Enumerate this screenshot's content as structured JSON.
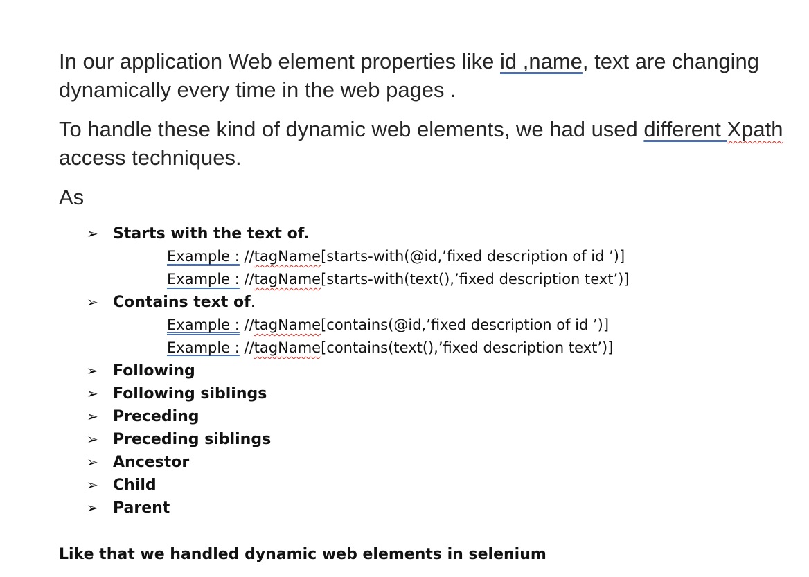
{
  "para1": {
    "text_a": "In our application Web element properties like ",
    "text_idname": "id ,name",
    "text_b": ", text are changing dynamically every time in the web pages ."
  },
  "para2": {
    "text_a": "To handle these kind of dynamic web elements, we had used ",
    "text_different": "different  ",
    "text_xpath": "Xpath",
    "text_b": " access techniques."
  },
  "para3": {
    "text": "As"
  },
  "bullet_glyph": "➢",
  "list": {
    "starts_with": "Starts with the text of.",
    "contains_label": "Contains text of",
    "contains_dot": ".",
    "following": "Following",
    "following_siblings": "Following siblings",
    "preceding": "Preceding",
    "preceding_siblings": "Preceding siblings",
    "ancestor": "Ancestor",
    "child": "Child",
    "parent": "Parent"
  },
  "examples": {
    "label": "Example :",
    "tag": "tagName",
    "prefix": " //",
    "starts_id_rest": "[starts-with(@id,’fixed description of id ’)]",
    "starts_text_rest": "[starts-with(text(),’fixed description text’)]",
    "contains_id_rest": "[contains(@id,’fixed description of id ’)]",
    "contains_text_rest": "[contains(text(),’fixed description text’)]"
  },
  "closing": "Like that we handled dynamic web elements in selenium"
}
